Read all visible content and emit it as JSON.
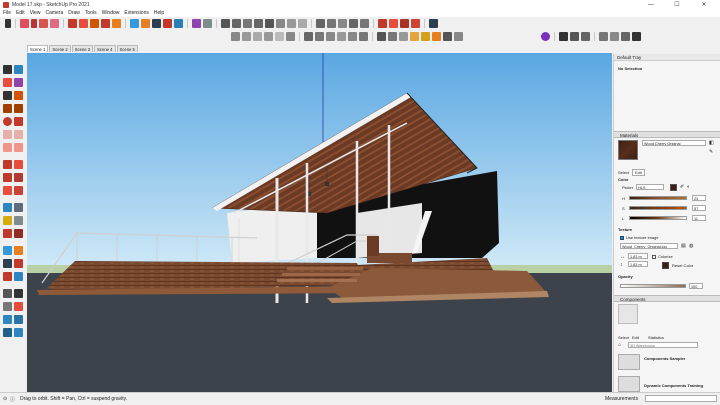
{
  "window": {
    "title": "Model 17.skp - SketchUp Pro 2021",
    "minimize": "—",
    "maximize": "☐",
    "close": "✕"
  },
  "menu": [
    "File",
    "Edit",
    "View",
    "Camera",
    "Draw",
    "Tools",
    "Window",
    "Extensions",
    "Help"
  ],
  "scenes": [
    "Scene 1",
    "Scene 2",
    "Scene 3",
    "Scene 4",
    "Scene 5"
  ],
  "active_scene": "Scene 1",
  "tray": {
    "title": "Default Tray",
    "selection": "No Selection",
    "materials": {
      "header": "Materials",
      "name": "Wood Cherry Original",
      "tabs": [
        "Select",
        "Edit"
      ],
      "color_label": "Color",
      "picker_label": "Picker",
      "picker_value": "HLS",
      "sliders": [
        {
          "label": "H",
          "value": "23"
        },
        {
          "label": "S",
          "value": "57"
        },
        {
          "label": "L",
          "value": "11"
        }
      ],
      "texture_label": "Texture",
      "use_texture_label": "Use texture image",
      "texture_file": "Wood_Cherry_Original.jpg",
      "width_value": "1,83 m",
      "height_value": "1,83 m",
      "colorize_label": "Colorize",
      "reset_color_label": "Reset Color",
      "opacity_label": "Opacity",
      "opacity_value": "100",
      "swatch_color": "#3b1f14"
    },
    "components": {
      "header": "Components",
      "tabs": [
        "Select",
        "Edit",
        "Statistics"
      ],
      "search_placeholder": "3D Warehouse",
      "items": [
        {
          "title": "Components Sampler"
        },
        {
          "title": "Dynamic Components Training"
        }
      ]
    }
  },
  "status": {
    "message": "Drag to orbit. Shift = Pan, Ctrl = suspend gravity.",
    "measurements_label": "Measurements"
  },
  "colors": {
    "sky_top": "#5ba9e3",
    "sky_bottom": "#cfe9f8",
    "ground": "#3d434b",
    "accent": "#7b2fbe"
  }
}
